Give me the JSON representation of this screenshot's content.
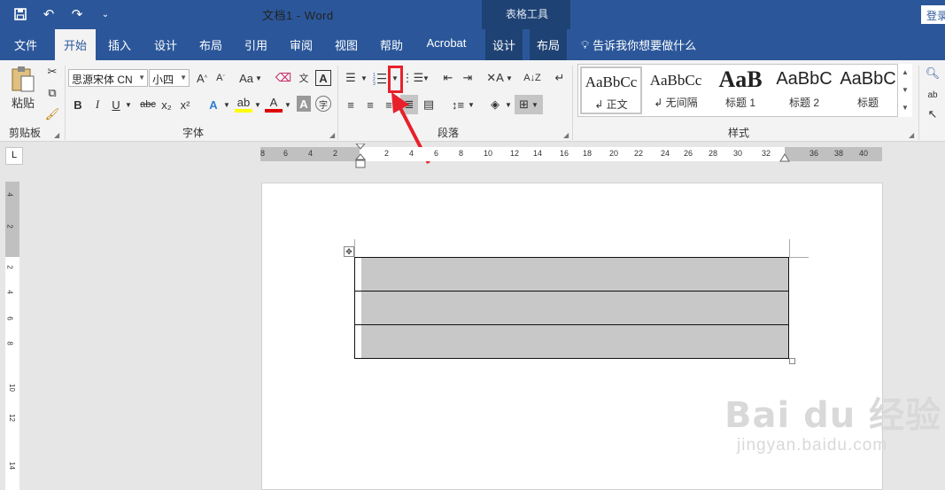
{
  "titlebar": {
    "doc_title": "文档1  -  Word",
    "contextual_tab": "表格工具",
    "login": "登录"
  },
  "tabs": [
    "文件",
    "开始",
    "插入",
    "设计",
    "布局",
    "引用",
    "审阅",
    "视图",
    "帮助",
    "Acrobat",
    "设计",
    "布局"
  ],
  "active_tab": "开始",
  "tell_me": "告诉我你想要做什么",
  "clipboard": {
    "paste": "粘贴",
    "group": "剪贴板"
  },
  "font": {
    "name": "思源宋体 CN",
    "size": "小四",
    "group": "字体",
    "buttons": {
      "bold": "B",
      "italic": "I",
      "underline": "U",
      "strike": "abc",
      "sub": "x₂",
      "sup": "x²",
      "case": "Aa",
      "grow": "A",
      "shrink": "A",
      "text_effect": "A",
      "font_color": "A",
      "char_shading": "A",
      "enclose": "字",
      "phonetic": "文"
    }
  },
  "paragraph": {
    "group": "段落"
  },
  "styles": {
    "group": "样式",
    "items": [
      {
        "sample": "AaBbCc",
        "name": "↲ 正文"
      },
      {
        "sample": "AaBbCc",
        "name": "↲ 无间隔"
      },
      {
        "sample": "AaB",
        "name": "标题 1"
      },
      {
        "sample": "AaBbC",
        "name": "标题 2"
      },
      {
        "sample": "AaBbC",
        "name": "标题"
      }
    ]
  },
  "ruler": {
    "h_ticks": [
      "8",
      "6",
      "4",
      "2",
      "2",
      "4",
      "6",
      "8",
      "10",
      "12",
      "14",
      "16",
      "18",
      "20",
      "22",
      "24",
      "26",
      "28",
      "30",
      "32",
      "36",
      "38",
      "40"
    ],
    "v_ticks": [
      "4",
      "2",
      "2",
      "4",
      "6",
      "8",
      "10",
      "12",
      "14"
    ],
    "corner": "L"
  },
  "table": {
    "rows": 3
  },
  "watermark": {
    "logo": "Bai du 经验",
    "url": "jingyan.baidu.com"
  },
  "colors": {
    "titlebar": "#2b579a",
    "contextual": "#1e4273",
    "annotation": "#e8202a",
    "cell_shade": "#c8c8c8"
  }
}
